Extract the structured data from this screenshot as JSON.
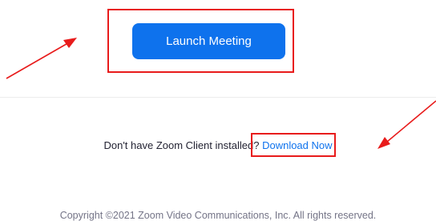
{
  "launch": {
    "button_label": "Launch Meeting"
  },
  "download": {
    "question": "Don't have Zoom Client installed?",
    "link_label": "Download Now"
  },
  "footer": {
    "copyright": "Copyright ©2021 Zoom Video Communications, Inc. All rights reserved."
  },
  "colors": {
    "brand_blue": "#0e72ed",
    "annotation_red": "#e81b1b",
    "footer_gray": "#747487"
  },
  "annotations": {
    "arrow_icon_left": "red-arrow-icon",
    "arrow_icon_right": "red-arrow-icon"
  }
}
